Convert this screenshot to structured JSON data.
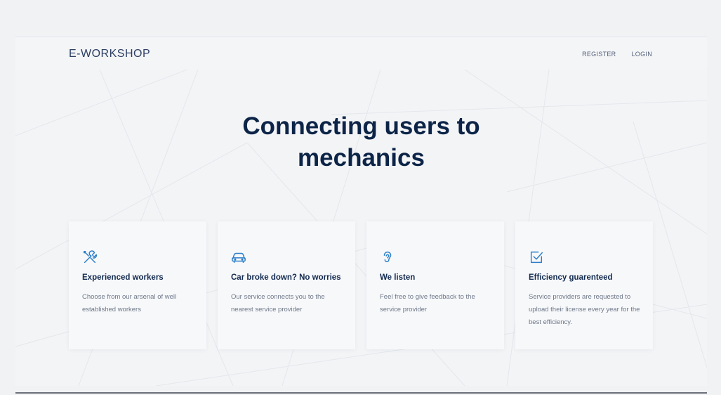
{
  "header": {
    "brand": "E-WORKSHOP",
    "nav": [
      {
        "label": "REGISTER"
      },
      {
        "label": "LOGIN"
      }
    ]
  },
  "hero": {
    "title_line1": "Connecting users to",
    "title_line2": "mechanics"
  },
  "features": [
    {
      "icon": "tools-icon",
      "title": "Experienced workers",
      "text": "Choose from our arsenal of well established workers"
    },
    {
      "icon": "car-icon",
      "title": "Car broke down? No worries",
      "text": "Our service connects you to the nearest service provider"
    },
    {
      "icon": "ear-icon",
      "title": "We listen",
      "text": "Feel free to give feedback to the service provider"
    },
    {
      "icon": "checkbox-icon",
      "title": "Efficiency guarenteed",
      "text": "Service providers are requested to upload their license every year for the best efficiency."
    }
  ],
  "colors": {
    "accent": "#2d7fc9",
    "heading": "#0c2447",
    "background": "#f3f4f6"
  }
}
